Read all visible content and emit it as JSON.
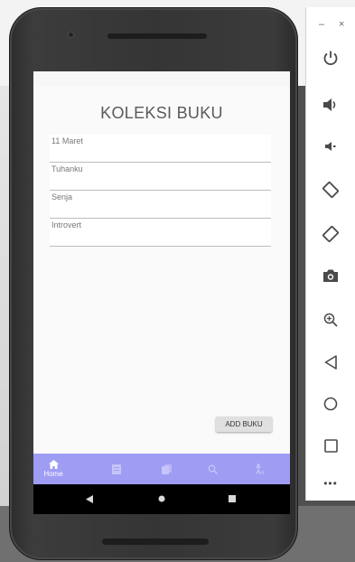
{
  "app": {
    "title": "KOLEKSI BUKU",
    "add_button_label": "ADD BUKU"
  },
  "books": [
    {
      "label": "11 Maret"
    },
    {
      "label": "Tuhanku"
    },
    {
      "label": "Senja"
    },
    {
      "label": "Introvert"
    }
  ],
  "bottom_nav": {
    "items": [
      {
        "id": "home",
        "label": "Home",
        "icon": "home-icon",
        "active": true
      },
      {
        "id": "books",
        "icon": "book-icon",
        "active": false
      },
      {
        "id": "library",
        "icon": "library-icon",
        "active": false
      },
      {
        "id": "search",
        "icon": "search-icon",
        "active": false
      },
      {
        "id": "accessibility",
        "icon": "accessibility-icon",
        "active": false
      }
    ],
    "background": "#9f9cf4"
  },
  "emulator_panel": {
    "window_controls": {
      "minimize": "–",
      "close": "×"
    },
    "buttons": [
      "power-icon",
      "volume-up-icon",
      "volume-down-icon",
      "rotate-left-icon",
      "rotate-right-icon",
      "camera-icon",
      "zoom-icon",
      "back-icon",
      "home-circle-icon",
      "overview-icon",
      "more-icon"
    ],
    "more_label": "•••"
  }
}
